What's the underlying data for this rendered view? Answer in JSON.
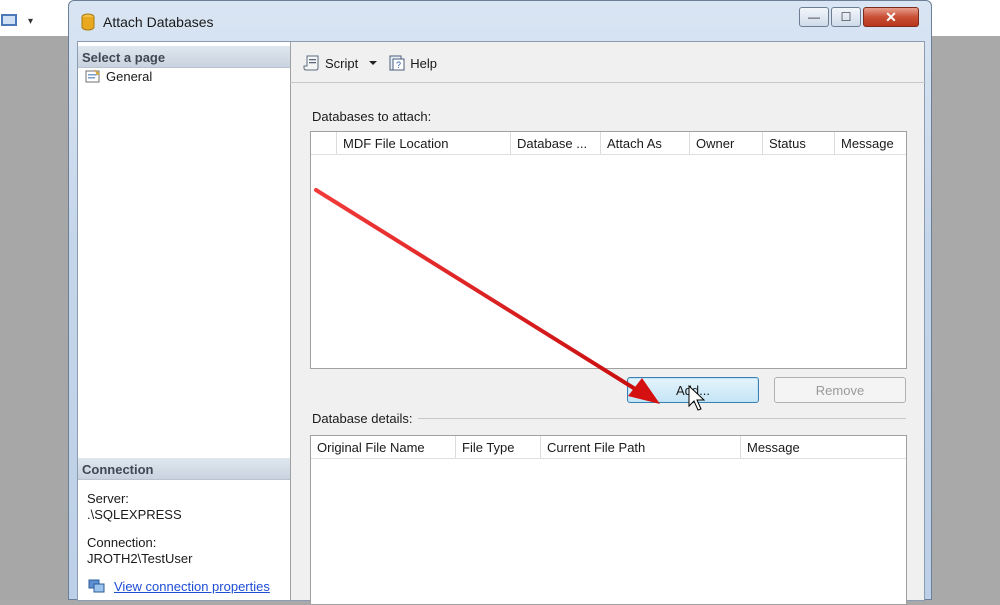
{
  "window": {
    "title": "Attach Databases",
    "controls": {
      "minimize": "—",
      "maximize": "☐",
      "close": "✕"
    }
  },
  "left_pane": {
    "select_page_header": "Select a page",
    "pages": [
      {
        "label": "General"
      }
    ],
    "connection_header": "Connection",
    "server_label": "Server:",
    "server_value": ".\\SQLEXPRESS",
    "connection_label": "Connection:",
    "connection_value": "JROTH2\\TestUser",
    "view_properties_link": "View connection properties"
  },
  "toolbar": {
    "script_label": "Script",
    "help_label": "Help"
  },
  "databases_to_attach": {
    "label": "Databases to attach:",
    "columns": [
      "MDF File Location",
      "Database ...",
      "Attach As",
      "Owner",
      "Status",
      "Message"
    ],
    "rows": []
  },
  "buttons": {
    "add_label": "Add...",
    "remove_label": "Remove"
  },
  "database_details": {
    "label": "Database details:",
    "columns": [
      "Original File Name",
      "File Type",
      "Current File Path",
      "Message"
    ],
    "rows": []
  },
  "colors": {
    "annotation_arrow": "#e01010",
    "link": "#1f4ed6",
    "close_button": "#c94f35"
  },
  "icons": {
    "window": "database-cylinder-icon",
    "page": "general-page-icon",
    "script": "script-scroll-icon",
    "dropdown": "dropdown-triangle-icon",
    "help": "help-book-icon",
    "connection": "connection-properties-icon",
    "cursor": "mouse-pointer-icon",
    "annotation": "red-arrow-annotation"
  }
}
